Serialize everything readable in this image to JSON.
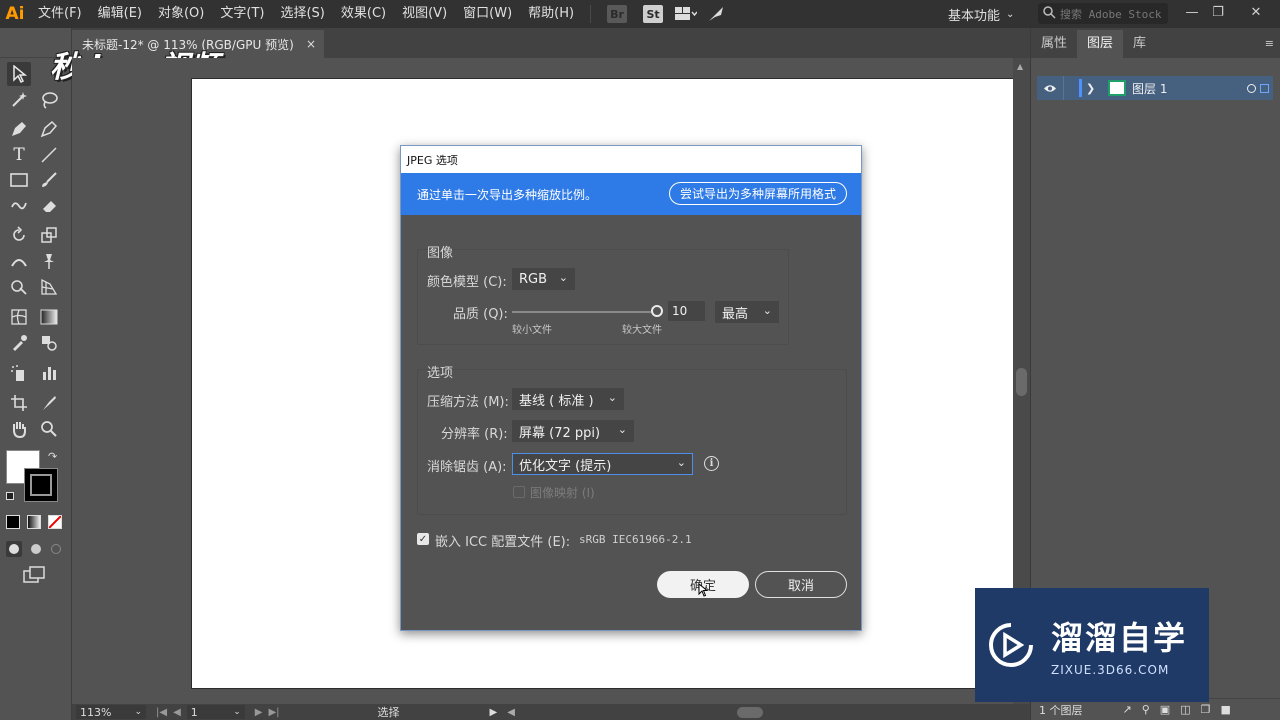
{
  "app": {
    "logo": "Ai",
    "menu": [
      "文件(F)",
      "编辑(E)",
      "对象(O)",
      "文字(T)",
      "选择(S)",
      "效果(C)",
      "视图(V)",
      "窗口(W)",
      "帮助(H)"
    ],
    "bridge_label": "Br",
    "stock_label": "St",
    "workspace": "基本功能",
    "stock_search_placeholder": "搜索 Adobe Stock"
  },
  "document": {
    "tab_title": "未标题-12* @ 113% (RGB/GPU 预览)",
    "close_label": "×"
  },
  "watermark_top": "秒dong视频",
  "status": {
    "zoom": "113%",
    "page": "1",
    "tool": "选择"
  },
  "right_panel": {
    "tabs": [
      "属性",
      "图层",
      "库"
    ],
    "active_tab": "图层",
    "layer_name": "图层 1",
    "layer_count": "1 个图层",
    "layer_color": "#1e9f6a"
  },
  "dialog": {
    "title": "JPEG 选项",
    "banner_text": "通过单击一次导出多种缩放比例。",
    "banner_button": "尝试导出为多种屏幕所用格式",
    "image_group": {
      "title": "图像",
      "color_model_label": "颜色模型 (C):",
      "color_model_value": "RGB",
      "quality_label": "品质 (Q):",
      "quality_value": "10",
      "quality_level": "最高",
      "quality_min_label": "较小文件",
      "quality_max_label": "较大文件",
      "quality_fraction": 1.0
    },
    "options_group": {
      "title": "选项",
      "compression_label": "压缩方法 (M):",
      "compression_value": "基线 ( 标准 )",
      "resolution_label": "分辨率 (R):",
      "resolution_value": "屏幕 (72 ppi)",
      "antialias_label": "消除锯齿 (A):",
      "antialias_value": "优化文字 (提示)",
      "imagemap_label": "图像映射 (I)"
    },
    "icc_label": "嵌入 ICC 配置文件 (E):",
    "icc_value": "sRGB IEC61966-2.1",
    "ok_label": "确定",
    "cancel_label": "取消"
  },
  "zixue": {
    "title": "溜溜自学",
    "subtitle": "ZIXUE.3D66.COM"
  }
}
